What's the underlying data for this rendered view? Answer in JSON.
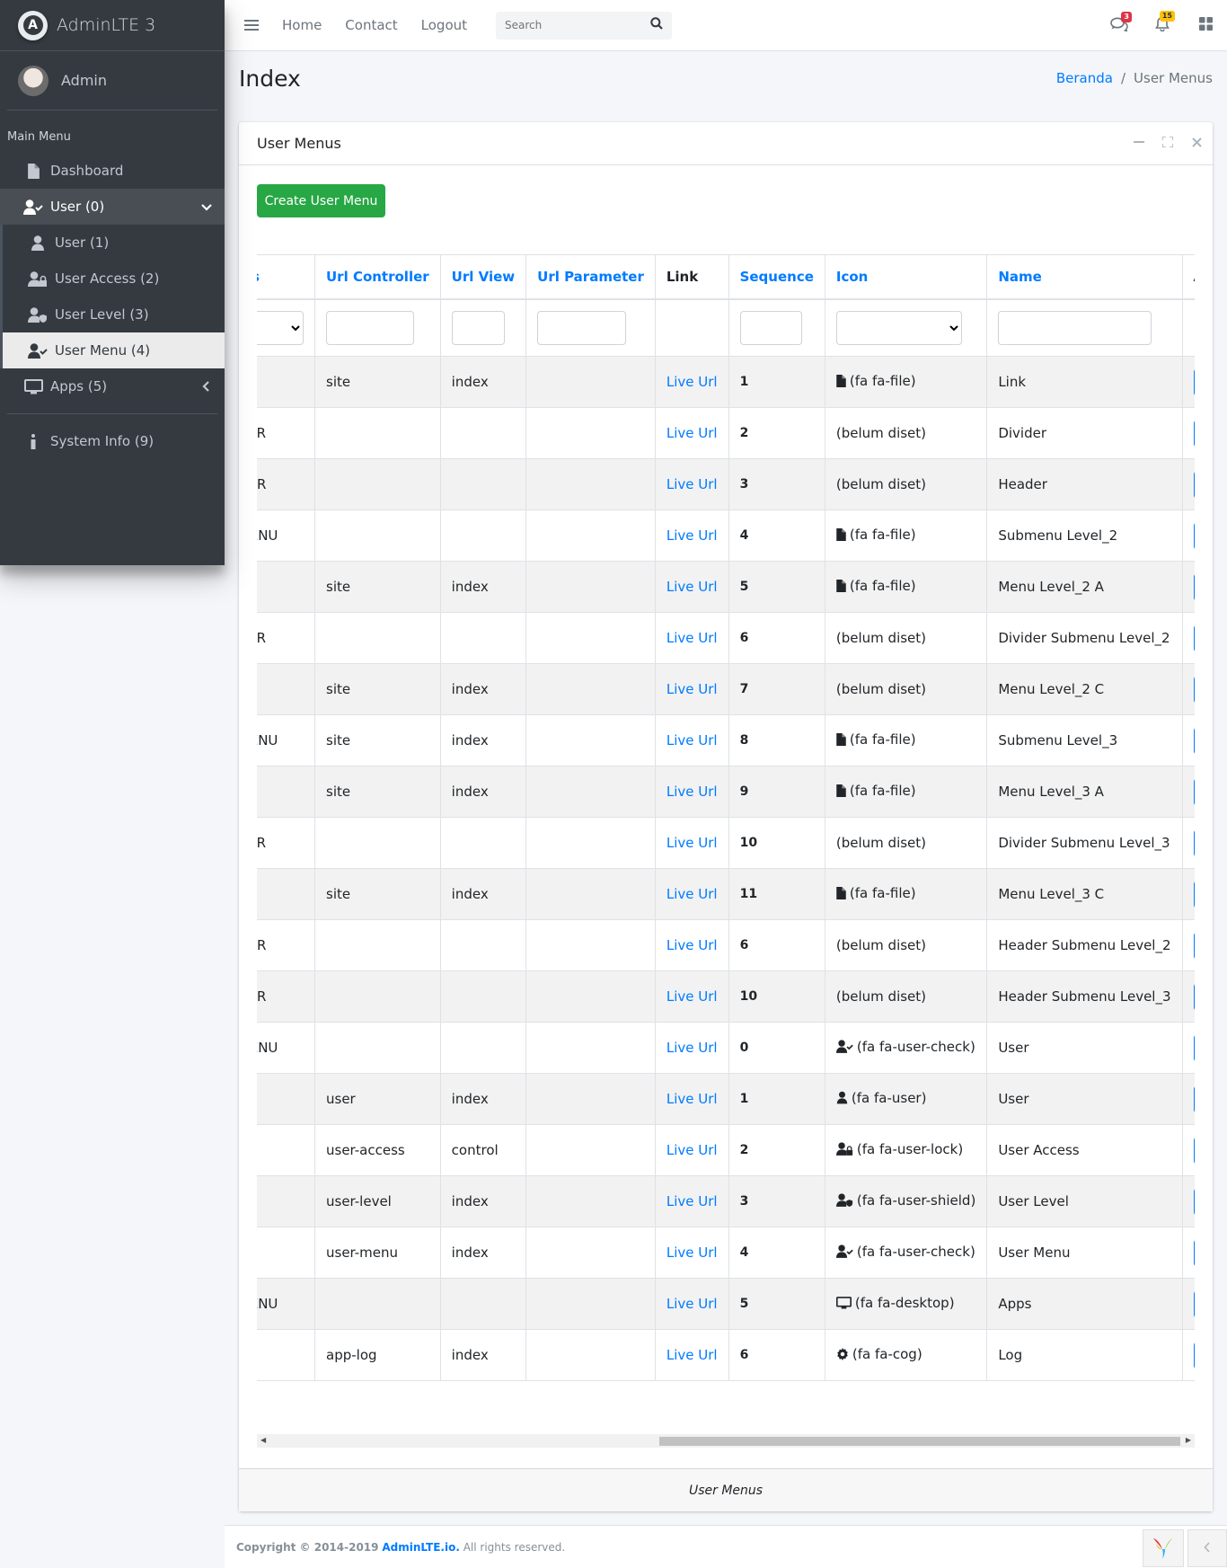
{
  "brand": {
    "name": "AdminLTE 3"
  },
  "user_panel": {
    "name": "Admin"
  },
  "sidebar": {
    "header": "Main Menu",
    "items": [
      {
        "label": "Dashboard",
        "icon": "file-icon"
      },
      {
        "label": "User (0)",
        "icon": "user-check-icon"
      },
      {
        "label": "User (1)",
        "icon": "user-icon"
      },
      {
        "label": "User Access (2)",
        "icon": "user-lock-icon"
      },
      {
        "label": "User Level (3)",
        "icon": "user-shield-icon"
      },
      {
        "label": "User Menu (4)",
        "icon": "user-check-icon"
      },
      {
        "label": "Apps (5)",
        "icon": "desktop-icon"
      },
      {
        "label": "System Info (9)",
        "icon": "info-icon"
      }
    ]
  },
  "topnav": {
    "links": [
      "Home",
      "Contact",
      "Logout"
    ],
    "search_placeholder": "Search",
    "messages_badge": "3",
    "notifications_badge": "15"
  },
  "content_header": {
    "title": "Index",
    "breadcrumb_home": "Beranda",
    "breadcrumb_current": "User Menus"
  },
  "card": {
    "title": "User Menus",
    "create_label": "Create User Menu",
    "footer": "User Menus"
  },
  "table": {
    "headers": [
      "Status",
      "Url Controller",
      "Url View",
      "Url Parameter",
      "Link",
      "Sequence",
      "Icon",
      "Name",
      "Action"
    ],
    "rows": [
      {
        "type": "",
        "controller": "site",
        "view": "index",
        "param": "",
        "link": "Live Url",
        "seq": "1",
        "icon_name": "file",
        "icon_text": "(fa fa-file)",
        "name": "Link"
      },
      {
        "type": "DIVIDER",
        "controller": "",
        "view": "",
        "param": "",
        "link": "Live Url",
        "seq": "2",
        "icon_name": "",
        "icon_text": "(belum diset)",
        "name": "Divider"
      },
      {
        "type": "HEADER",
        "controller": "",
        "view": "",
        "param": "",
        "link": "Live Url",
        "seq": "3",
        "icon_name": "",
        "icon_text": "(belum diset)",
        "name": "Header"
      },
      {
        "type": "SUBMENU",
        "controller": "",
        "view": "",
        "param": "",
        "link": "Live Url",
        "seq": "4",
        "icon_name": "file",
        "icon_text": "(fa fa-file)",
        "name": "Submenu Level_2"
      },
      {
        "type": "",
        "controller": "site",
        "view": "index",
        "param": "",
        "link": "Live Url",
        "seq": "5",
        "icon_name": "file",
        "icon_text": "(fa fa-file)",
        "name": "Menu Level_2 A"
      },
      {
        "type": "DIVIDER",
        "controller": "",
        "view": "",
        "param": "",
        "link": "Live Url",
        "seq": "6",
        "icon_name": "",
        "icon_text": "(belum diset)",
        "name": "Divider Submenu Level_2"
      },
      {
        "type": "",
        "controller": "site",
        "view": "index",
        "param": "",
        "link": "Live Url",
        "seq": "7",
        "icon_name": "",
        "icon_text": "(belum diset)",
        "name": "Menu Level_2 C"
      },
      {
        "type": "SUBMENU",
        "controller": "site",
        "view": "index",
        "param": "",
        "link": "Live Url",
        "seq": "8",
        "icon_name": "file",
        "icon_text": "(fa fa-file)",
        "name": "Submenu Level_3"
      },
      {
        "type": "",
        "controller": "site",
        "view": "index",
        "param": "",
        "link": "Live Url",
        "seq": "9",
        "icon_name": "file",
        "icon_text": "(fa fa-file)",
        "name": "Menu Level_3 A"
      },
      {
        "type": "DIVIDER",
        "controller": "",
        "view": "",
        "param": "",
        "link": "Live Url",
        "seq": "10",
        "icon_name": "",
        "icon_text": "(belum diset)",
        "name": "Divider Submenu Level_3"
      },
      {
        "type": "",
        "controller": "site",
        "view": "index",
        "param": "",
        "link": "Live Url",
        "seq": "11",
        "icon_name": "file",
        "icon_text": "(fa fa-file)",
        "name": "Menu Level_3 C"
      },
      {
        "type": "HEADER",
        "controller": "",
        "view": "",
        "param": "",
        "link": "Live Url",
        "seq": "6",
        "icon_name": "",
        "icon_text": "(belum diset)",
        "name": "Header Submenu Level_2"
      },
      {
        "type": "HEADER",
        "controller": "",
        "view": "",
        "param": "",
        "link": "Live Url",
        "seq": "10",
        "icon_name": "",
        "icon_text": "(belum diset)",
        "name": "Header Submenu Level_3"
      },
      {
        "type": "SUBMENU",
        "controller": "",
        "view": "",
        "param": "",
        "link": "Live Url",
        "seq": "0",
        "icon_name": "user-check",
        "icon_text": "(fa fa-user-check)",
        "name": "User"
      },
      {
        "type": "",
        "controller": "user",
        "view": "index",
        "param": "",
        "link": "Live Url",
        "seq": "1",
        "icon_name": "user",
        "icon_text": "(fa fa-user)",
        "name": "User"
      },
      {
        "type": "",
        "controller": "user-access",
        "view": "control",
        "param": "",
        "link": "Live Url",
        "seq": "2",
        "icon_name": "user-lock",
        "icon_text": "(fa fa-user-lock)",
        "name": "User Access"
      },
      {
        "type": "",
        "controller": "user-level",
        "view": "index",
        "param": "",
        "link": "Live Url",
        "seq": "3",
        "icon_name": "user-shield",
        "icon_text": "(fa fa-user-shield)",
        "name": "User Level"
      },
      {
        "type": "",
        "controller": "user-menu",
        "view": "index",
        "param": "",
        "link": "Live Url",
        "seq": "4",
        "icon_name": "user-check",
        "icon_text": "(fa fa-user-check)",
        "name": "User Menu"
      },
      {
        "type": "SUBMENU",
        "controller": "",
        "view": "",
        "param": "",
        "link": "Live Url",
        "seq": "5",
        "icon_name": "desktop",
        "icon_text": "(fa fa-desktop)",
        "name": "Apps"
      },
      {
        "type": "",
        "controller": "app-log",
        "view": "index",
        "param": "",
        "link": "Live Url",
        "seq": "6",
        "icon_name": "cog",
        "icon_text": "(fa fa-cog)",
        "name": "Log"
      }
    ]
  },
  "footer": {
    "copyright": "Copyright © 2014-2019",
    "brand_link": "AdminLTE.io.",
    "rights": "All rights reserved."
  },
  "colors": {
    "primary": "#007bff",
    "success": "#28a745",
    "danger": "#dc3545",
    "sidebar": "#343a40"
  }
}
